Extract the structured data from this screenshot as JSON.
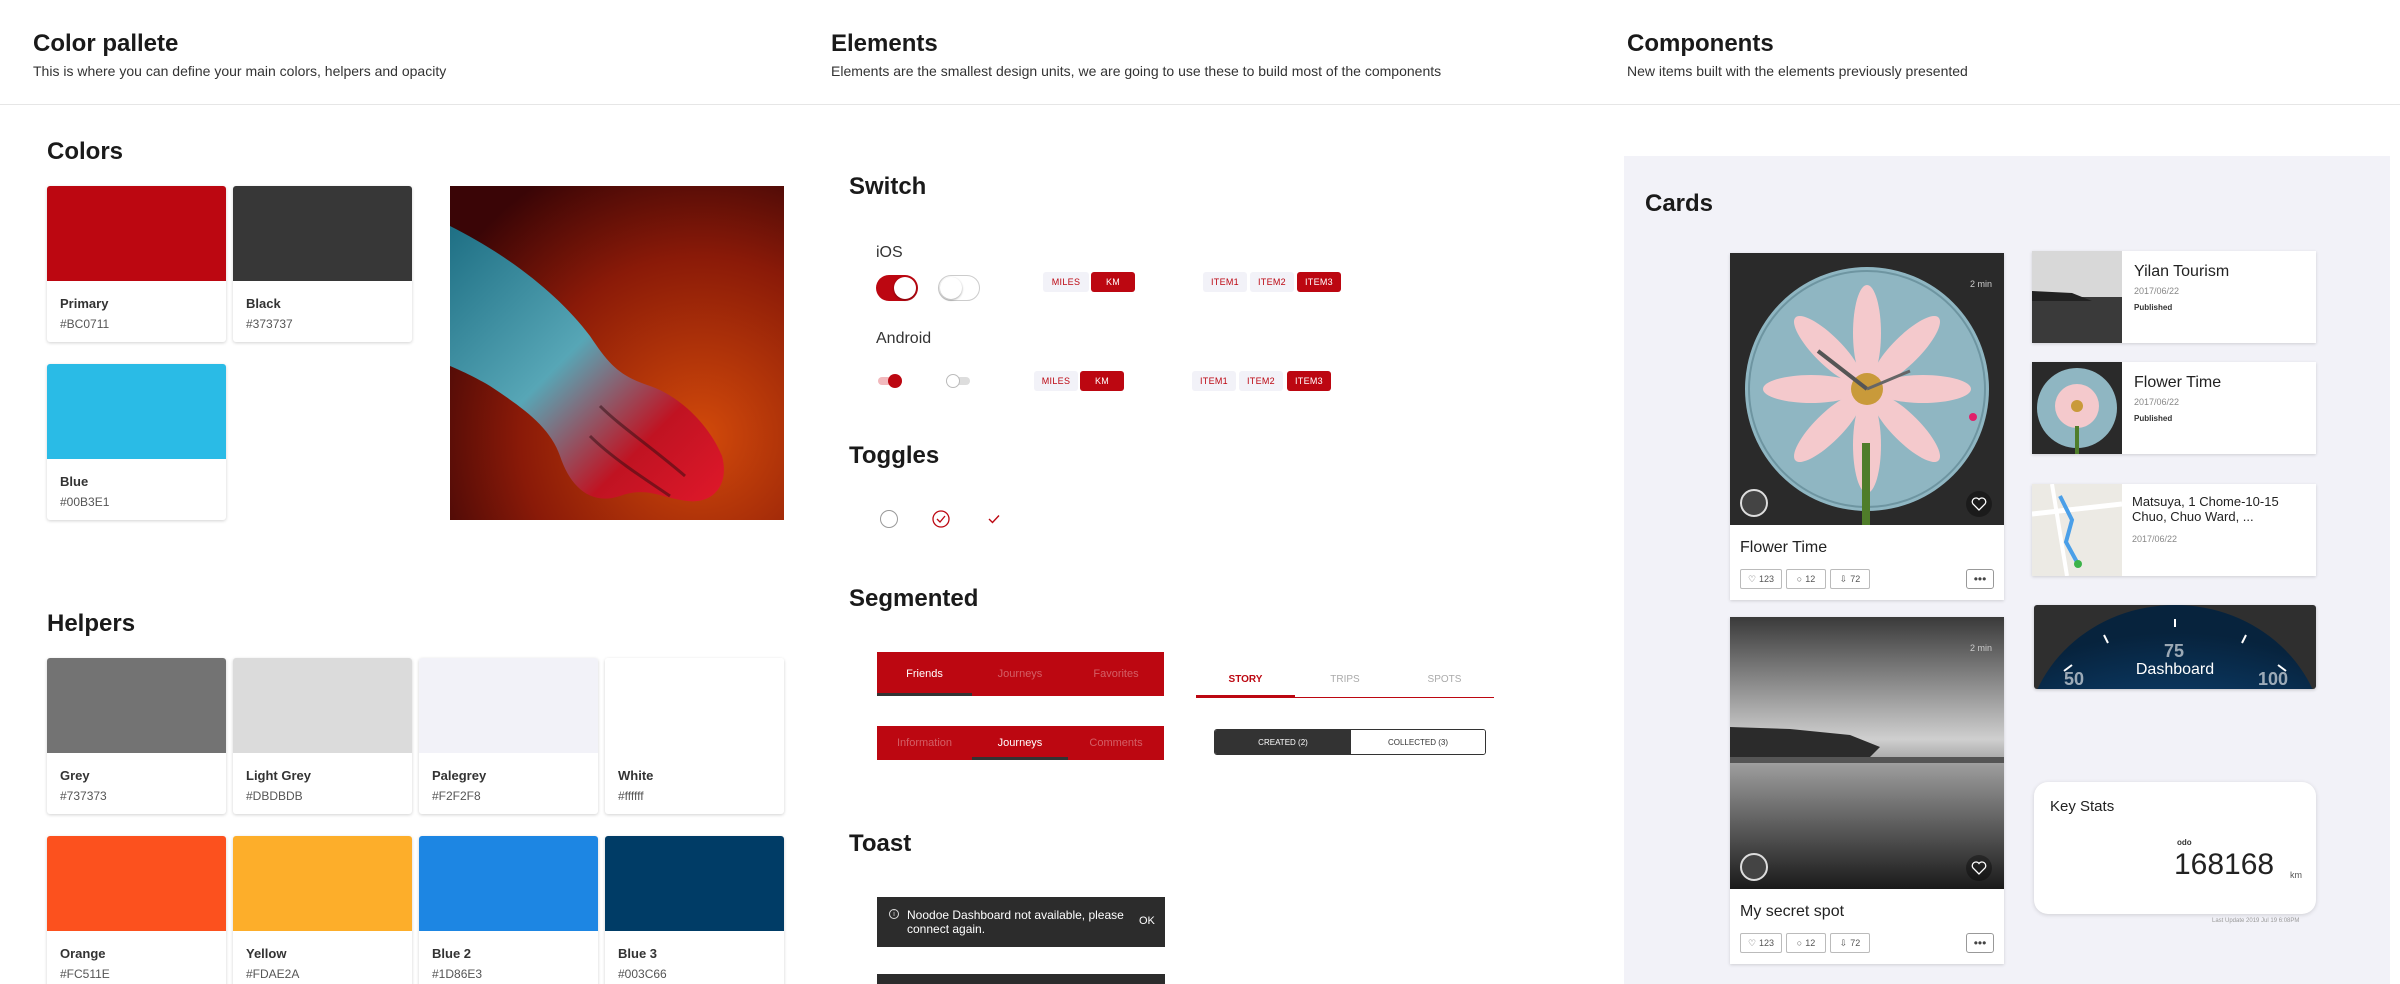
{
  "header": {
    "palette_title": "Color pallete",
    "palette_sub": "This is where you can define your main colors, helpers and opacity",
    "elements_title": "Elements",
    "elements_sub": "Elements are the smallest design units, we are going to use these to build most of the components",
    "components_title": "Components",
    "components_sub": "New items built with the elements previously presented"
  },
  "colors": {
    "title": "Colors",
    "items": [
      {
        "name": "Primary",
        "hex": "#BC0711"
      },
      {
        "name": "Black",
        "hex": "#373737"
      },
      {
        "name": "Blue",
        "hex": "#00B3E1"
      }
    ]
  },
  "helpers": {
    "title": "Helpers",
    "items": [
      {
        "name": "Grey",
        "hex": "#737373"
      },
      {
        "name": "Light Grey",
        "hex": "#DBDBDB"
      },
      {
        "name": "Palegrey",
        "hex": "#F2F2F8"
      },
      {
        "name": "White",
        "hex": "#ffffff"
      },
      {
        "name": "Orange",
        "hex": "#FC511E"
      },
      {
        "name": "Yellow",
        "hex": "#FDAE2A"
      },
      {
        "name": "Blue 2",
        "hex": "#1D86E3"
      },
      {
        "name": "Blue 3",
        "hex": "#003C66"
      }
    ]
  },
  "switch": {
    "title": "Switch",
    "ios_label": "iOS",
    "android_label": "Android",
    "miles": "MILES",
    "km": "KM",
    "item1": "ITEM1",
    "item2": "ITEM2",
    "item3": "ITEM3"
  },
  "toggles": {
    "title": "Toggles"
  },
  "segmented": {
    "title": "Segmented",
    "red_tabs_1": [
      "Friends",
      "Journeys",
      "Favorites"
    ],
    "red_tabs_2": [
      "Information",
      "Journeys",
      "Comments"
    ],
    "line_tabs": [
      "STORY",
      "TRIPS",
      "SPOTS"
    ],
    "created": "CREATED (2)",
    "collected": "COLLECTED (3)"
  },
  "toast": {
    "title": "Toast",
    "message": "Noodoe Dashboard not available, please connect again.",
    "ok": "OK"
  },
  "cards": {
    "title": "Cards",
    "big": [
      {
        "title": "Flower Time",
        "mins": "2 min",
        "likes": "123",
        "comments": "12",
        "downloads": "72",
        "more": "•••"
      },
      {
        "title": "My secret spot",
        "mins": "2 min",
        "likes": "123",
        "comments": "12",
        "downloads": "72",
        "more": "•••"
      }
    ],
    "list": [
      {
        "title": "Yilan Tourism",
        "date": "2017/06/22",
        "status": "Published"
      },
      {
        "title": "Flower Time",
        "date": "2017/06/22",
        "status": "Published"
      },
      {
        "title": "Matsuya, 1 Chome-10-15 Chuo, Chuo Ward, ...",
        "date": "2017/06/22"
      }
    ],
    "dashboard": {
      "label": "Dashboard",
      "n50": "50",
      "n75": "75",
      "n100": "100"
    },
    "keystats": {
      "title": "Key Stats",
      "odo_label": "odo",
      "value": "168168",
      "unit": "km",
      "updated": "Last Update 2019 Jul 19 6:08PM"
    }
  }
}
